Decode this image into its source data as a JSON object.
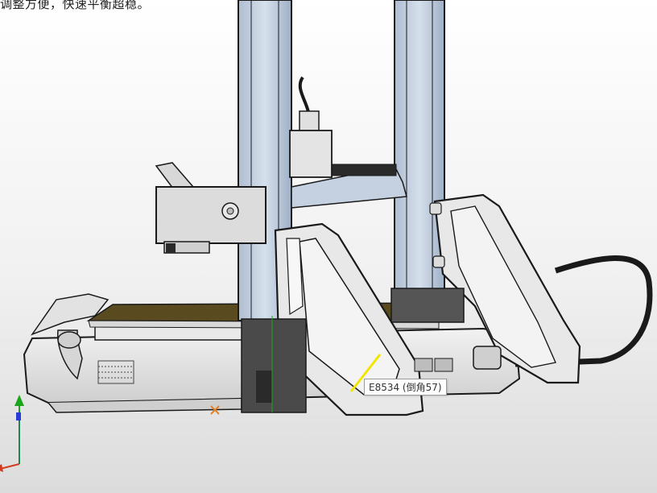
{
  "viewport": {
    "caption": "调整方便，快速平衡超稳。",
    "tooltip": "E8534 (倒角57)"
  },
  "colors": {
    "background_top": "#ffffff",
    "background_bottom": "#dcdcdc",
    "frame_blue": "#c7d3e2",
    "part_gray": "#e6e6e6",
    "outline": "#1a1a1a",
    "bed_surface": "#5a4a1f",
    "highlight_edge": "#f2e600",
    "axis_y": "#1aa51a",
    "axis_z": "#2a3bd8",
    "axis_x": "#d63a1e"
  },
  "icons": {
    "axis_triad": "xyz-axis-triad-icon"
  }
}
